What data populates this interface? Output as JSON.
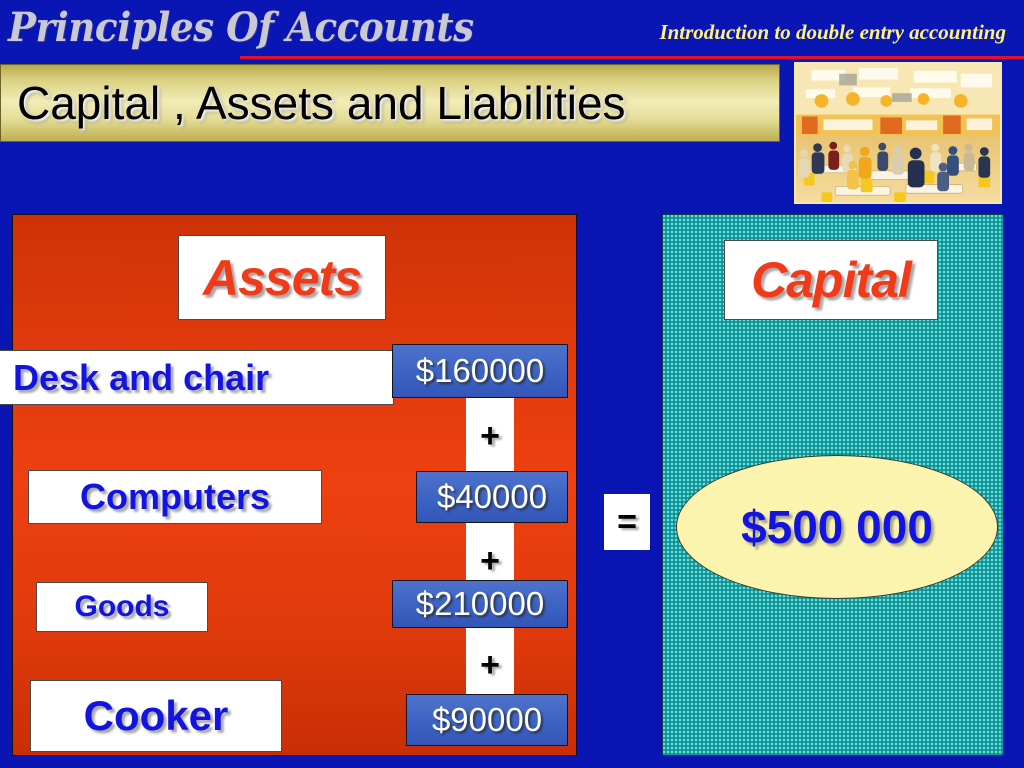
{
  "header": {
    "brand": "Principles Of Accounts",
    "subtitle": "Introduction to double entry accounting",
    "title": "Capital , Assets and Liabilities",
    "photo_alt": "food-court-photo"
  },
  "assets": {
    "heading": "Assets",
    "rows": [
      {
        "label": "Desk and chair",
        "amount": "$160000"
      },
      {
        "label": "Computers",
        "amount": "$40000"
      },
      {
        "label": "Goods",
        "amount": "$210000"
      },
      {
        "label": "Cooker",
        "amount": "$90000"
      }
    ],
    "operators": [
      "+",
      "+",
      "+"
    ]
  },
  "equation": {
    "equals": "="
  },
  "capital": {
    "heading": "Capital",
    "total": "$500 000"
  },
  "colors": {
    "background_blue": "#0A16B4",
    "assets_red": "#E03A0C",
    "capital_teal": "#16A3A3",
    "amount_blue": "#3C63C4",
    "title_gold": "#F2ECB8",
    "ellipse_yellow": "#FAF4AE",
    "heading_orange": "#F03A18",
    "label_blue": "#1414E0",
    "subtitle_yellow": "#FFF27A",
    "rule_red": "#E01030"
  }
}
